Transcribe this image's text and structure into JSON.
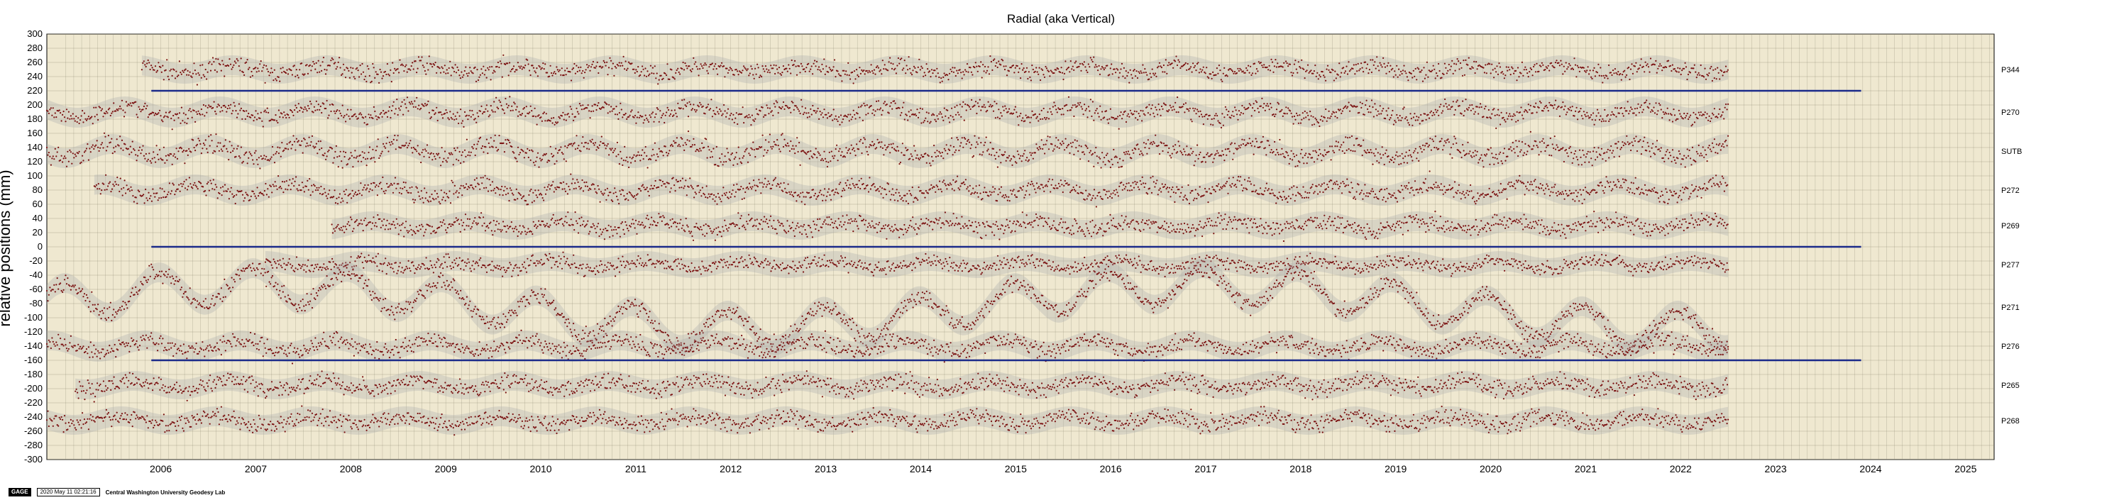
{
  "chart_data": {
    "type": "scatter",
    "title": "Radial (aka Vertical)",
    "xlabel": "",
    "ylabel": "relative positions (mm)",
    "xlim": [
      2005.3,
      2025.8
    ],
    "ylim": [
      -300,
      300
    ],
    "y_tick_step": 20,
    "x_ticks": [
      "2006",
      "2007",
      "2008",
      "2009",
      "2010",
      "2011",
      "2012",
      "2013",
      "2014",
      "2015",
      "2016",
      "2017",
      "2018",
      "2019",
      "2020",
      "2021",
      "2022",
      "2023",
      "2024",
      "2025"
    ],
    "grid": true,
    "series": [
      {
        "name": "P344",
        "offset": 250,
        "start": 2006.3,
        "end": 2023.0,
        "noise": 6,
        "amp": 6
      },
      {
        "name": "P270",
        "offset": 190,
        "start": 2005.3,
        "end": 2023.0,
        "noise": 6,
        "amp": 8
      },
      {
        "name": "SUTB",
        "offset": 135,
        "start": 2005.3,
        "end": 2023.0,
        "noise": 7,
        "amp": 10
      },
      {
        "name": "P272",
        "offset": 80,
        "start": 2005.8,
        "end": 2023.0,
        "noise": 6,
        "amp": 8
      },
      {
        "name": "P269",
        "offset": 30,
        "start": 2008.3,
        "end": 2023.0,
        "noise": 6,
        "amp": 6
      },
      {
        "name": "P277",
        "offset": -25,
        "start": 2007.6,
        "end": 2023.0,
        "noise": 5,
        "amp": 5
      },
      {
        "name": "P271",
        "offset": -85,
        "start": 2005.3,
        "end": 2023.0,
        "noise": 6,
        "amp": 25
      },
      {
        "name": "P276",
        "offset": -140,
        "start": 2005.3,
        "end": 2023.0,
        "noise": 6,
        "amp": 8
      },
      {
        "name": "P265",
        "offset": -195,
        "start": 2005.6,
        "end": 2023.0,
        "noise": 6,
        "amp": 6
      },
      {
        "name": "P268",
        "offset": -245,
        "start": 2005.3,
        "end": 2023.0,
        "noise": 6,
        "amp": 6
      }
    ],
    "reference_lines": [
      {
        "y": 220,
        "x_start": 2006.4,
        "x_end": 2024.4
      },
      {
        "y": 0,
        "x_start": 2006.4,
        "x_end": 2024.4
      },
      {
        "y": -160,
        "x_start": 2006.4,
        "x_end": 2024.4
      }
    ],
    "colors": {
      "background": "#efe8d0",
      "grid": "#8a8570",
      "points": "#7a1010",
      "uncertainty": "#b0b0b0",
      "reference": "#1a2a8a"
    }
  },
  "footer": {
    "badge": "GAGE",
    "timestamp": "2020 May 11 02:21:16",
    "lab": "Central Washington University Geodesy Lab"
  }
}
